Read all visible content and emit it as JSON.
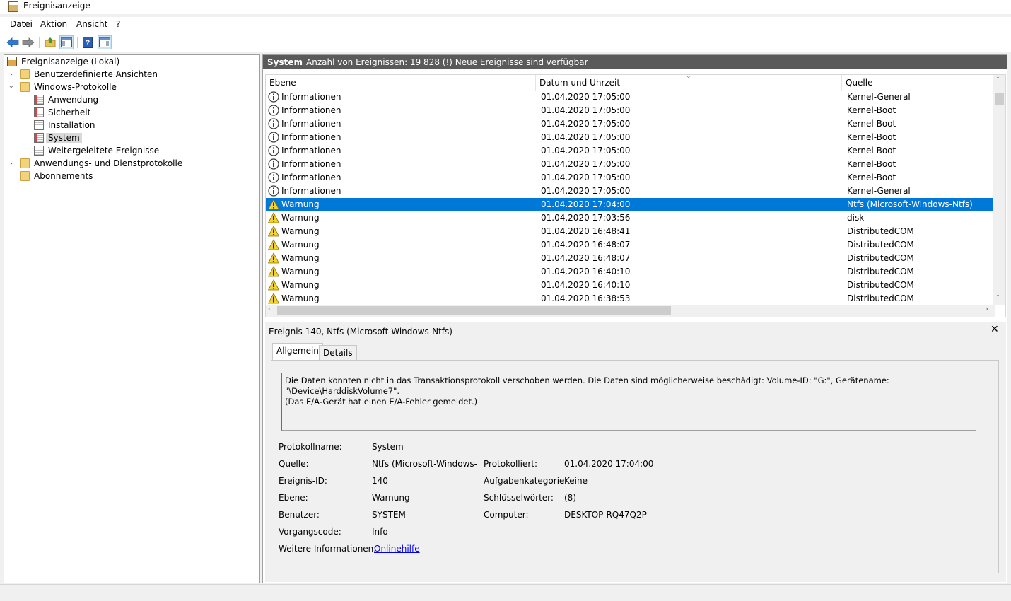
{
  "window": {
    "title": "Ereignisanzeige"
  },
  "menu": [
    "Datei",
    "Aktion",
    "Ansicht",
    "?"
  ],
  "tree": {
    "root": "Ereignisanzeige (Lokal)",
    "custom_views": "Benutzerdefinierte Ansichten",
    "windows_logs": "Windows-Protokolle",
    "windows_logs_items": [
      "Anwendung",
      "Sicherheit",
      "Installation",
      "System",
      "Weitergeleitete Ereignisse"
    ],
    "app_logs": "Anwendungs- und Dienstprotokolle",
    "subscriptions": "Abonnements",
    "selected": "System"
  },
  "pane_header": {
    "name": "System",
    "info": "Anzahl von Ereignissen: 19 828 (!) Neue Ereignisse sind verfügbar"
  },
  "grid": {
    "columns": [
      "Ebene",
      "Datum und Uhrzeit",
      "Quelle"
    ],
    "rows": [
      {
        "level": "Informationen",
        "type": "info",
        "datetime": "01.04.2020 17:05:00",
        "source": "Kernel-General"
      },
      {
        "level": "Informationen",
        "type": "info",
        "datetime": "01.04.2020 17:05:00",
        "source": "Kernel-Boot"
      },
      {
        "level": "Informationen",
        "type": "info",
        "datetime": "01.04.2020 17:05:00",
        "source": "Kernel-Boot"
      },
      {
        "level": "Informationen",
        "type": "info",
        "datetime": "01.04.2020 17:05:00",
        "source": "Kernel-Boot"
      },
      {
        "level": "Informationen",
        "type": "info",
        "datetime": "01.04.2020 17:05:00",
        "source": "Kernel-Boot"
      },
      {
        "level": "Informationen",
        "type": "info",
        "datetime": "01.04.2020 17:05:00",
        "source": "Kernel-Boot"
      },
      {
        "level": "Informationen",
        "type": "info",
        "datetime": "01.04.2020 17:05:00",
        "source": "Kernel-Boot"
      },
      {
        "level": "Informationen",
        "type": "info",
        "datetime": "01.04.2020 17:05:00",
        "source": "Kernel-General"
      },
      {
        "level": "Warnung",
        "type": "warn",
        "datetime": "01.04.2020 17:04:00",
        "source": "Ntfs (Microsoft-Windows-Ntfs)",
        "selected": true
      },
      {
        "level": "Warnung",
        "type": "warn",
        "datetime": "01.04.2020 17:03:56",
        "source": "disk"
      },
      {
        "level": "Warnung",
        "type": "warn",
        "datetime": "01.04.2020 16:48:41",
        "source": "DistributedCOM"
      },
      {
        "level": "Warnung",
        "type": "warn",
        "datetime": "01.04.2020 16:48:07",
        "source": "DistributedCOM"
      },
      {
        "level": "Warnung",
        "type": "warn",
        "datetime": "01.04.2020 16:48:07",
        "source": "DistributedCOM"
      },
      {
        "level": "Warnung",
        "type": "warn",
        "datetime": "01.04.2020 16:40:10",
        "source": "DistributedCOM"
      },
      {
        "level": "Warnung",
        "type": "warn",
        "datetime": "01.04.2020 16:40:10",
        "source": "DistributedCOM"
      },
      {
        "level": "Warnung",
        "type": "warn",
        "datetime": "01.04.2020 16:38:53",
        "source": "DistributedCOM"
      }
    ]
  },
  "detail": {
    "title": "Ereignis 140, Ntfs (Microsoft-Windows-Ntfs)",
    "close": "✕",
    "tabs": [
      "Allgemein",
      "Details"
    ],
    "message": "Die Daten konnten nicht in das Transaktionsprotokoll verschoben werden. Die Daten sind möglicherweise beschädigt: Volume-ID: \"G:\", Gerätename: \"\\Device\\HarddiskVolume7\".\n(Das E/A-Gerät hat einen E/A-Fehler gemeldet.)",
    "fields": {
      "log_name_label": "Protokollname:",
      "log_name": "System",
      "source_label": "Quelle:",
      "source": "Ntfs (Microsoft-Windows-N",
      "logged_label": "Protokolliert:",
      "logged": "01.04.2020 17:04:00",
      "event_id_label": "Ereignis-ID:",
      "event_id": "140",
      "task_label": "Aufgabenkategorie:",
      "task": "Keine",
      "level_label": "Ebene:",
      "level": "Warnung",
      "keywords_label": "Schlüsselwörter:",
      "keywords": "(8)",
      "user_label": "Benutzer:",
      "user": "SYSTEM",
      "computer_label": "Computer:",
      "computer": "DESKTOP-RQ47Q2P",
      "opcode_label": "Vorgangscode:",
      "opcode": "Info",
      "more_info_label": "Weitere Informationen:",
      "more_info_link": "Onlinehilfe"
    }
  },
  "colors": {
    "selection": "#0078d7",
    "header_bar": "#5a5a5a",
    "link": "#0000ee"
  },
  "icons": [
    "back-arrow-icon",
    "forward-arrow-icon",
    "up-folder-icon",
    "show-hide-tree-icon",
    "help-icon",
    "show-hide-action-icon",
    "info-icon",
    "warning-icon"
  ]
}
